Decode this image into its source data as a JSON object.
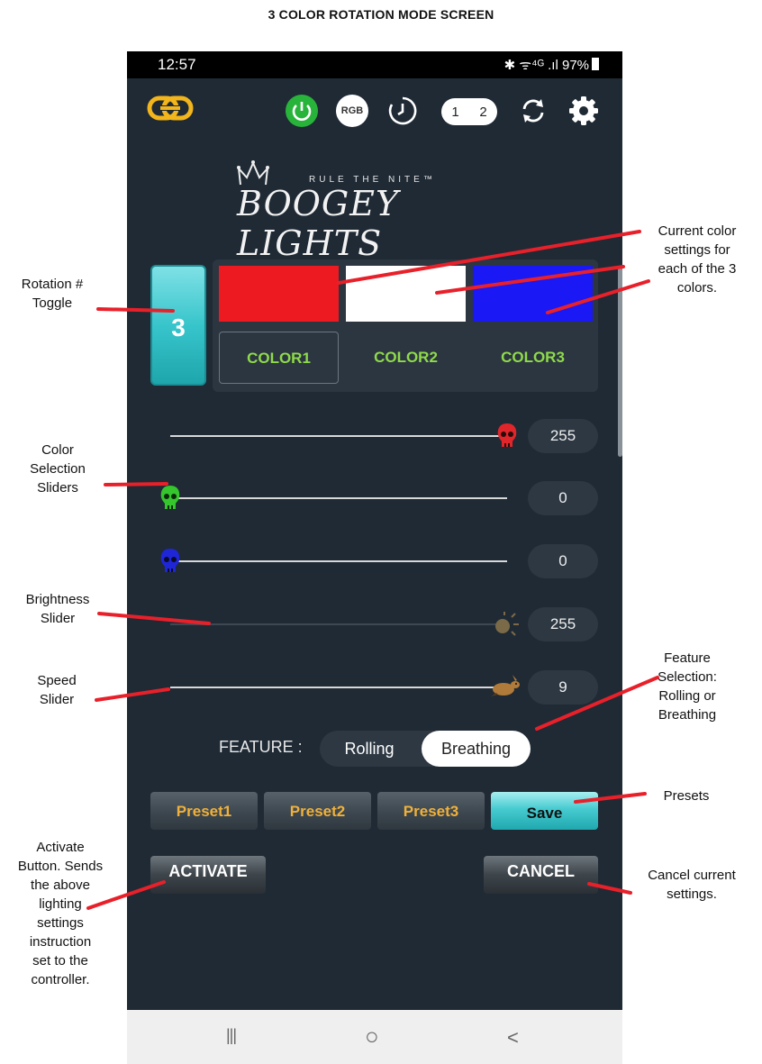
{
  "page_title": "3 COLOR ROTATION MODE SCREEN",
  "status_bar": {
    "time": "12:57",
    "right": "✱ ᯤ⁴ᴳ .ıl 97%"
  },
  "toolbar": {
    "rgb_label": "RGB",
    "toggle_1": "1",
    "toggle_2": "2"
  },
  "logo": {
    "tagline": "RULE THE NITE™",
    "brand": "BOOGEY LIGHTS"
  },
  "rotation_toggle": {
    "value": "3"
  },
  "colors": [
    {
      "label": "COLOR1",
      "swatch": "#ee1a22",
      "active": true
    },
    {
      "label": "COLOR2",
      "swatch": "#ffffff",
      "active": false
    },
    {
      "label": "COLOR3",
      "swatch": "#1a18f5",
      "active": false
    }
  ],
  "sliders": {
    "red": {
      "value": "255",
      "level": 1.0,
      "knob_color": "#e0262a"
    },
    "green": {
      "value": "0",
      "level": 0.0,
      "knob_color": "#35c52c"
    },
    "blue": {
      "value": "0",
      "level": 0.0,
      "knob_color": "#1e26d8"
    },
    "brightness": {
      "value": "255",
      "level": 1.0
    },
    "speed": {
      "value": "9",
      "level": 1.0
    }
  },
  "feature": {
    "label": "FEATURE :",
    "options": [
      "Rolling",
      "Breathing"
    ],
    "selected": "Breathing"
  },
  "presets": {
    "p1": "Preset1",
    "p2": "Preset2",
    "p3": "Preset3",
    "save": "Save"
  },
  "actions": {
    "activate": "ACTIVATE",
    "cancel": "CANCEL"
  },
  "navbar": {
    "recent": "|||",
    "home": "○",
    "back": "<"
  },
  "annotations": {
    "rotation_toggle": "Rotation #\nToggle",
    "current_colors": "Current color\nsettings for\neach of the 3\ncolors.",
    "color_sliders": "Color\nSelection\nSliders",
    "brightness": "Brightness\nSlider",
    "speed": "Speed\nSlider",
    "feature": "Feature\nSelection:\nRolling or\nBreathing",
    "presets": "Presets",
    "activate": "Activate\nButton. Sends\nthe above\nlighting\nsettings\ninstruction\nset to the\ncontroller.",
    "cancel": "Cancel current\nsettings."
  },
  "accent_colors": {
    "annotation_line": "#e8202a",
    "app_bg": "#1f2a35",
    "preset_text": "#f0b13a",
    "color_btn_text": "#8fda4a"
  }
}
